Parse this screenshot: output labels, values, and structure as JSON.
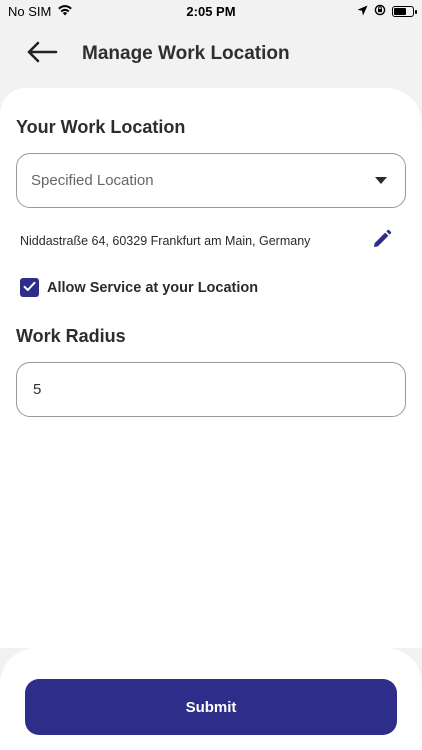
{
  "status_bar": {
    "carrier": "No SIM",
    "time": "2:05 PM",
    "battery_level": 0.7
  },
  "header": {
    "title": "Manage Work Location",
    "back_icon": "arrow-left-icon"
  },
  "work_location": {
    "title": "Your Work Location",
    "select_value": "Specified Location",
    "address": "Niddastraße 64, 60329 Frankfurt am Main, Germany",
    "edit_icon": "pencil-icon"
  },
  "allow_service": {
    "label": "Allow Service at your Location",
    "checked": true
  },
  "work_radius": {
    "title": "Work Radius",
    "value": "5"
  },
  "footer": {
    "submit_label": "Submit"
  },
  "colors": {
    "accent": "#2e2d8a",
    "background": "#f2f2f2",
    "card": "#ffffff"
  }
}
